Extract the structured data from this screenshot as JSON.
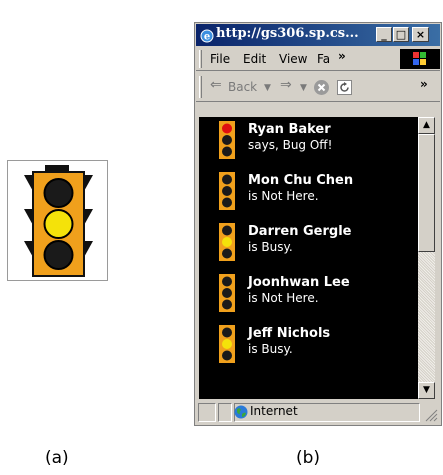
{
  "figure_a": {
    "caption": "(a)",
    "light_state": "yellow"
  },
  "figure_b": {
    "caption": "(b)",
    "window": {
      "title": "http://gs306.sp.cs...",
      "controls": {
        "minimize": "_",
        "maximize": "□",
        "close": "×"
      },
      "menu": [
        "File",
        "Edit",
        "View",
        "Fa"
      ],
      "toolbar": {
        "back": "Back",
        "forward_icon": "arrow-right",
        "stop_icon": "stop",
        "refresh_icon": "refresh"
      },
      "status_zone": "Internet"
    },
    "people": [
      {
        "name": "Ryan Baker",
        "status": "says, Bug Off!",
        "light": "red"
      },
      {
        "name": "Mon Chu Chen",
        "status": "is Not Here.",
        "light": "off"
      },
      {
        "name": "Darren Gergle",
        "status": "is Busy.",
        "light": "yellow"
      },
      {
        "name": "Joonhwan Lee",
        "status": "is Not Here.",
        "light": "off"
      },
      {
        "name": "Jeff Nichols",
        "status": "is Busy.",
        "light": "yellow"
      }
    ]
  },
  "colors": {
    "housing": "#f0a01c",
    "red": "#e01010",
    "yellow": "#f4e20a",
    "off": "#1a1a1a",
    "titlebar": "#0a246a"
  }
}
